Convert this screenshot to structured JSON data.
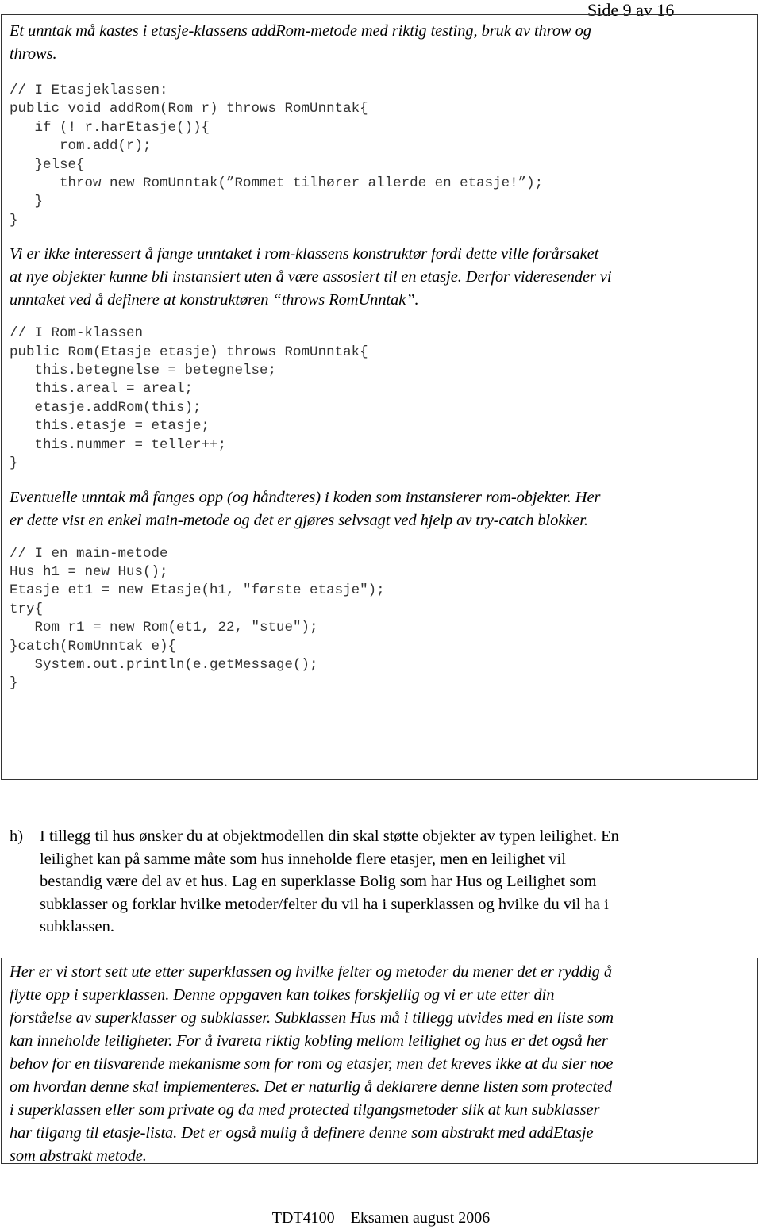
{
  "header": {
    "page_label": "Side 9 av 16"
  },
  "answer_box_1": {
    "intro_lines": [
      "Et unntak må kastes i etasje-klassens addRom-metode med riktig testing, bruk av throw og",
      "throws."
    ],
    "code_block_1": [
      "// I Etasjeklassen:",
      "public void addRom(Rom r) throws RomUnntak{",
      "   if (! r.harEtasje()){",
      "      rom.add(r);",
      "   }else{",
      "      throw new RomUnntak(”Rommet tilhører allerde en etasje!”);",
      "   }",
      "}"
    ],
    "explanation_lines": [
      "Vi er ikke interessert å fange unntaket i rom-klassens konstruktør fordi dette ville forårsaket",
      "at nye objekter kunne bli instansiert uten å være assosiert til en etasje. Derfor videresender vi",
      "unntaket ved å definere at konstruktøren “throws RomUnntak”."
    ],
    "code_block_2": [
      "// I Rom-klassen",
      "public Rom(Etasje etasje) throws RomUnntak{",
      "   this.betegnelse = betegnelse;",
      "   this.areal = areal;",
      "   etasje.addRom(this);",
      "   this.etasje = etasje;",
      "   this.nummer = teller++;",
      "}"
    ],
    "handling_lines": [
      "Eventuelle unntak må fanges opp (og håndteres) i koden som instansierer rom-objekter. Her",
      "er dette vist en enkel main-metode og det er gjøres selvsagt ved hjelp av try-catch blokker."
    ],
    "code_block_3": [
      "// I en main-metode",
      "Hus h1 = new Hus();",
      "Etasje et1 = new Etasje(h1, \"første etasje\");",
      "try{",
      "   Rom r1 = new Rom(et1, 22, \"stue\");",
      "}catch(RomUnntak e){",
      "   System.out.println(e.getMessage();",
      "}"
    ]
  },
  "task_h": {
    "label": "h)",
    "lines": [
      "I tillegg til hus ønsker du at objektmodellen din skal støtte objekter av typen leilighet. En",
      "leilighet kan på samme måte som hus inneholde flere etasjer, men en leilighet vil",
      "bestandig være del av et hus. Lag en superklasse Bolig som har Hus og Leilighet som",
      "subklasser og forklar hvilke metoder/felter du vil ha i superklassen og hvilke du vil ha i",
      "subklassen."
    ]
  },
  "answer_box_2": {
    "lines": [
      "Her er vi stort sett ute etter superklassen og hvilke felter og metoder du mener det er ryddig å",
      "flytte opp i superklassen. Denne oppgaven kan tolkes forskjellig og vi er ute etter din",
      "forståelse av superklasser og subklasser. Subklassen Hus må i tillegg utvides med en liste som",
      "kan inneholde leiligheter. For å ivareta riktig kobling mellom leilighet og hus er det også her",
      "behov for en tilsvarende mekanisme som for rom og etasjer, men det kreves ikke at du sier noe",
      "om hvordan denne skal implementeres. Det er naturlig å deklarere denne listen som protected",
      "i superklassen eller som private og da med protected tilgangsmetoder slik at kun subklasser",
      "har tilgang til etasje-lista. Det er også mulig å definere denne som abstrakt med addEtasje",
      "som abstrakt metode."
    ]
  },
  "footer": {
    "text": "TDT4100 – Eksamen august 2006"
  }
}
